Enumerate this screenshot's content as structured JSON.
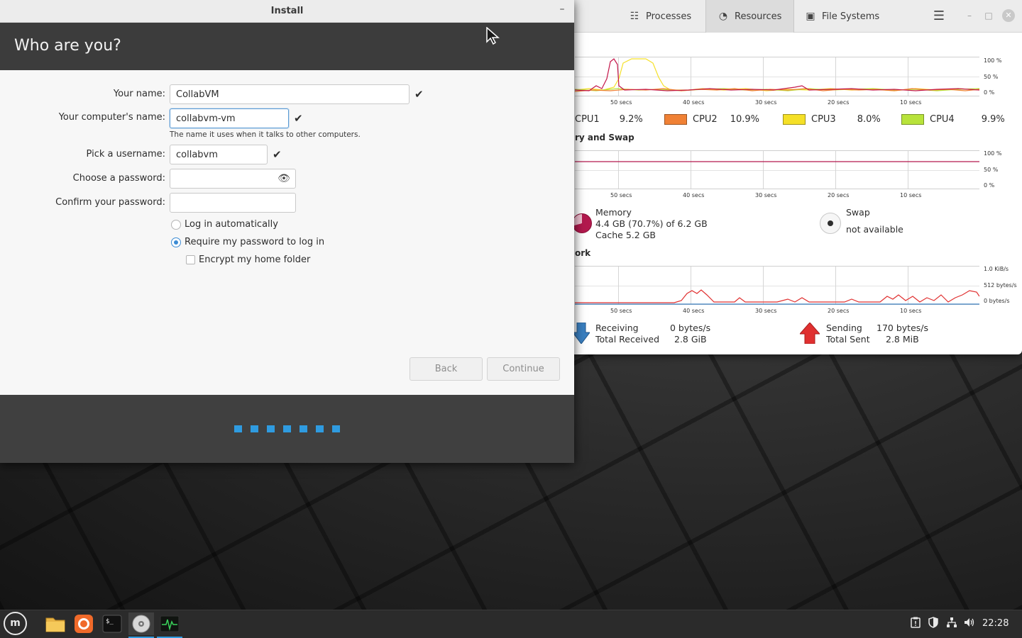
{
  "install": {
    "window_title": "Install",
    "minimize_symbol": "–",
    "heading": "Who are you?",
    "fields": {
      "name_label": "Your name:",
      "name_value": "CollabVM",
      "computer_label": "Your computer's name:",
      "computer_value": "collabvm-vm",
      "computer_hint": "The name it uses when it talks to other computers.",
      "username_label": "Pick a username:",
      "username_value": "collabvm",
      "password_label": "Choose a password:",
      "password_value": "",
      "confirm_label": "Confirm your password:",
      "confirm_value": ""
    },
    "options": {
      "auto_login": "Log in automatically",
      "require_password": "Require my password to log in",
      "encrypt_home": "Encrypt my home folder"
    },
    "buttons": {
      "back": "Back",
      "continue": "Continue"
    },
    "check_symbol": "✔",
    "eye_symbol": "👁",
    "progress_dots": 7,
    "accent_color": "#2f9be0"
  },
  "sysmon": {
    "tabs": [
      {
        "label": "Processes",
        "icon": "list-icon"
      },
      {
        "label": "Resources",
        "icon": "gauge-icon"
      },
      {
        "label": "File Systems",
        "icon": "disk-icon"
      }
    ],
    "menu_symbol": "☰",
    "minimize_symbol": "–",
    "maximize_symbol": "□",
    "close_symbol": "✕",
    "cpu_section_y_ticks": [
      "100 %",
      "50 %",
      "0 %"
    ],
    "x_ticks": [
      "50 secs",
      "40 secs",
      "30 secs",
      "20 secs",
      "10 secs"
    ],
    "cpus": [
      {
        "label": "CPU1",
        "value": "9.2%",
        "color": "#c4164a"
      },
      {
        "label": "CPU2",
        "value": "10.9%",
        "color": "#f08135"
      },
      {
        "label": "CPU3",
        "value": "8.0%",
        "color": "#f5e027"
      },
      {
        "label": "CPU4",
        "value": "9.9%",
        "color": "#b8e33b"
      }
    ],
    "memory_section_title": "ry and Swap",
    "memory_y_ticks": [
      "100 %",
      "50 %",
      "0 %"
    ],
    "memory": {
      "title": "Memory",
      "usage": "4.4 GB (70.7%) of 6.2 GB",
      "cache": "Cache 5.2 GB",
      "used_fraction": 0.707,
      "color": "#b3194e"
    },
    "swap": {
      "title": "Swap",
      "status": "not available"
    },
    "network_section_title": "ork",
    "network_y_ticks": [
      "1.0 KiB/s",
      "512 bytes/s",
      "0 bytes/s"
    ],
    "network": {
      "receiving_label": "Receiving",
      "receiving_value": "0 bytes/s",
      "total_received_label": "Total Received",
      "total_received_value": "2.8 GiB",
      "sending_label": "Sending",
      "sending_value": "170 bytes/s",
      "total_sent_label": "Total Sent",
      "total_sent_value": "2.8 MiB",
      "receive_color": "#3a7fc0",
      "send_color": "#e03030"
    }
  },
  "taskbar": {
    "menu_logo": "m",
    "apps": [
      {
        "name": "files-icon"
      },
      {
        "name": "firefox-icon"
      },
      {
        "name": "terminal-icon"
      },
      {
        "name": "install-disc-icon"
      },
      {
        "name": "system-monitor-icon"
      }
    ],
    "tray_icons": [
      "clipboard-icon",
      "shield-icon",
      "network-icon",
      "volume-icon"
    ],
    "clock": "22:28"
  }
}
